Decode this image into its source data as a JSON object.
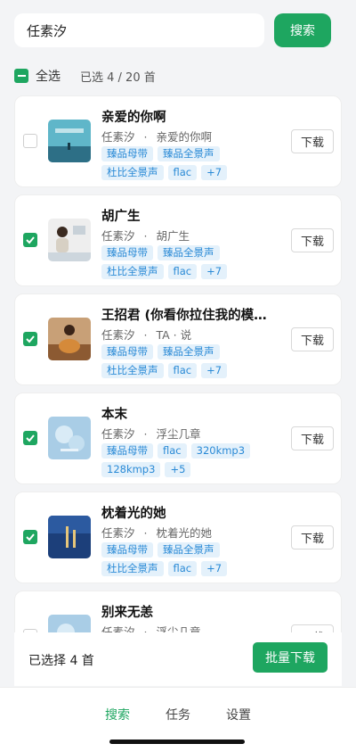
{
  "search": {
    "value": "任素汐",
    "button_label": "搜索"
  },
  "selection": {
    "select_all_label": "全选",
    "count_text": "已选 4 / 20 首"
  },
  "songs": [
    {
      "title": "亲爱的你啊",
      "artist": "任素汐",
      "separator": "·",
      "album": "亲爱的你啊",
      "tags": [
        "臻品母带",
        "臻品全景声",
        "杜比全景声",
        "flac",
        "+7"
      ],
      "checked": false,
      "download_label": "下载"
    },
    {
      "title": "胡广生",
      "artist": "任素汐",
      "separator": "·",
      "album": "胡广生",
      "tags": [
        "臻品母带",
        "臻品全景声",
        "杜比全景声",
        "flac",
        "+7"
      ],
      "checked": true,
      "download_label": "下载"
    },
    {
      "title": "王招君 (你看你拉住我的模…",
      "artist": "任素汐",
      "separator": "·",
      "album": "TA · 说",
      "tags": [
        "臻品母带",
        "臻品全景声",
        "杜比全景声",
        "flac",
        "+7"
      ],
      "checked": true,
      "download_label": "下载"
    },
    {
      "title": "本末",
      "artist": "任素汐",
      "separator": "·",
      "album": "浮尘几章",
      "tags": [
        "臻品母带",
        "flac",
        "320kmp3",
        "128kmp3",
        "+5"
      ],
      "checked": true,
      "download_label": "下载"
    },
    {
      "title": "枕着光的她",
      "artist": "任素汐",
      "separator": "·",
      "album": "枕着光的她",
      "tags": [
        "臻品母带",
        "臻品全景声",
        "杜比全景声",
        "flac",
        "+7"
      ],
      "checked": true,
      "download_label": "下载"
    },
    {
      "title": "别来无恙",
      "artist": "任素汐",
      "separator": "·",
      "album": "浮尘几章",
      "tags": [],
      "checked": false,
      "download_label": "下载"
    }
  ],
  "bottom": {
    "selected_text": "已选择 4 首",
    "batch_label": "批量下载"
  },
  "nav": [
    {
      "label": "搜索",
      "active": true
    },
    {
      "label": "任务",
      "active": false
    },
    {
      "label": "设置",
      "active": false
    }
  ],
  "colors": {
    "accent": "#1ea660",
    "tag_bg": "#e4f1fb",
    "tag_text": "#2a8ad6"
  }
}
